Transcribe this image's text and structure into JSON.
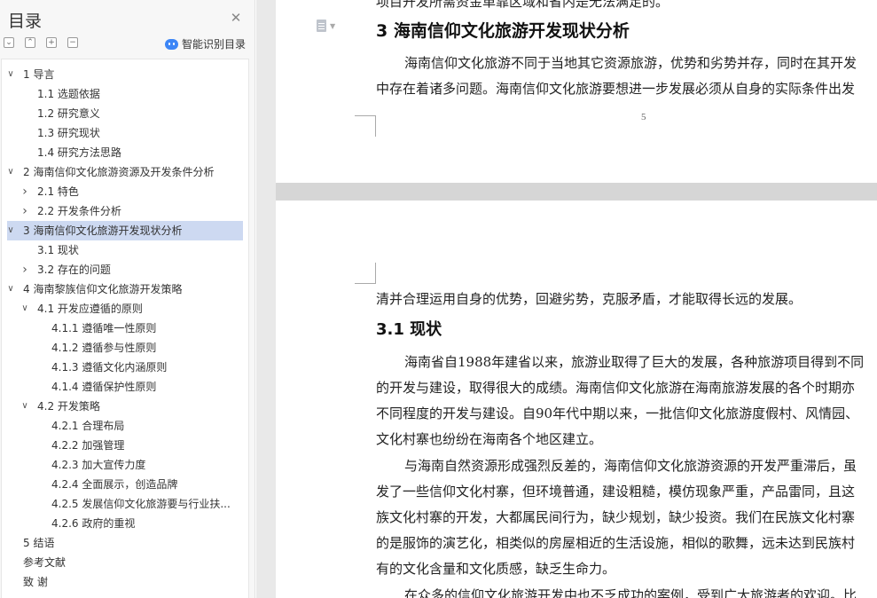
{
  "sidebar": {
    "title": "目录",
    "smart_toc_label": "智能识别目录",
    "toc": [
      {
        "label": "1  导言",
        "level": 1,
        "expander": "expanded"
      },
      {
        "label": "1.1 选题依据",
        "level": 2,
        "expander": "none"
      },
      {
        "label": "1.2 研究意义",
        "level": 2,
        "expander": "none"
      },
      {
        "label": "1.3 研究现状",
        "level": 2,
        "expander": "none"
      },
      {
        "label": "1.4 研究方法思路",
        "level": 2,
        "expander": "none"
      },
      {
        "label": "2  海南信仰文化旅游资源及开发条件分析",
        "level": 1,
        "expander": "expanded"
      },
      {
        "label": "2.1 特色",
        "level": 2,
        "expander": "collapsed"
      },
      {
        "label": "2.2 开发条件分析",
        "level": 2,
        "expander": "collapsed"
      },
      {
        "label": "3  海南信仰文化旅游开发现状分析",
        "level": 1,
        "expander": "expanded",
        "active": true
      },
      {
        "label": "3.1 现状",
        "level": 2,
        "expander": "none"
      },
      {
        "label": "3.2 存在的问题",
        "level": 2,
        "expander": "collapsed"
      },
      {
        "label": "4  海南黎族信仰文化旅游开发策略",
        "level": 1,
        "expander": "expanded"
      },
      {
        "label": "4.1 开发应遵循的原则",
        "level": 2,
        "expander": "expanded"
      },
      {
        "label": "4.1.1 遵循唯一性原则",
        "level": 3,
        "expander": "none"
      },
      {
        "label": "4.1.2 遵循参与性原则",
        "level": 3,
        "expander": "none"
      },
      {
        "label": "4.1.3 遵循文化内涵原则",
        "level": 3,
        "expander": "none"
      },
      {
        "label": "4.1.4 遵循保护性原则",
        "level": 3,
        "expander": "none"
      },
      {
        "label": "4.2 开发策略",
        "level": 2,
        "expander": "expanded"
      },
      {
        "label": "4.2.1 合理布局",
        "level": 3,
        "expander": "none"
      },
      {
        "label": "4.2.2 加强管理",
        "level": 3,
        "expander": "none"
      },
      {
        "label": "4.2.3 加大宣传力度",
        "level": 3,
        "expander": "none"
      },
      {
        "label": "4.2.4 全面展示，创造品牌",
        "level": 3,
        "expander": "none"
      },
      {
        "label": "4.2.5 发展信仰文化旅游要与行业扶...",
        "level": 3,
        "expander": "none"
      },
      {
        "label": "4.2.6 政府的重视",
        "level": 3,
        "expander": "none"
      },
      {
        "label": "5  结语",
        "level": 1,
        "expander": "none"
      },
      {
        "label": "参考文献",
        "level": 1,
        "expander": "none"
      },
      {
        "label": "致  谢",
        "level": 1,
        "expander": "none"
      }
    ]
  },
  "document": {
    "page1": {
      "top_fragment": "项目开发所需资金单靠区域和省内是无法满足的。",
      "heading": "3  海南信仰文化旅游开发现状分析",
      "para_line1": "海南信仰文化旅游不同于当地其它资源旅游，优势和劣势并存，同时在其开发",
      "para_line2": "中存在着诸多问题。海南信仰文化旅游要想进一步发展必须从自身的实际条件出发",
      "page_number": "5"
    },
    "page2": {
      "line0": "清并合理运用自身的优势，回避劣势，克服矛盾，才能取得长远的发展。",
      "heading": "3.1 现状",
      "p1_lines": [
        "海南省自1988年建省以来，旅游业取得了巨大的发展，各种旅游项目得到不同",
        "的开发与建设，取得很大的成绩。海南信仰文化旅游在海南旅游发展的各个时期亦",
        "不同程度的开发与建设。自90年代中期以来，一批信仰文化旅游度假村、风情园、",
        "文化村寨也纷纷在海南各个地区建立。"
      ],
      "p2_lines": [
        "与海南自然资源形成强烈反差的，海南信仰文化旅游资源的开发严重滞后，虽",
        "发了一些信仰文化村寨，但环境普通，建设粗糙，模仿现象严重，产品雷同，且这",
        "族文化村寨的开发，大都属民间行为，缺少规划，缺少投资。我们在民族文化村寨",
        "的是服饰的演艺化，相类似的房屋相近的生活设施，相似的歌舞，远未达到民族村",
        "有的文化含量和文化质感，缺乏生命力。"
      ],
      "p3_line": "在众多的信仰文化旅游开发中也不乏成功的案例，受到广大旅游者的欢迎。比"
    }
  },
  "colors": {
    "active_toc_bg": "#cdd9f1",
    "smart_icon": "#3d86f6",
    "doc_background": "#d6d6d6"
  }
}
